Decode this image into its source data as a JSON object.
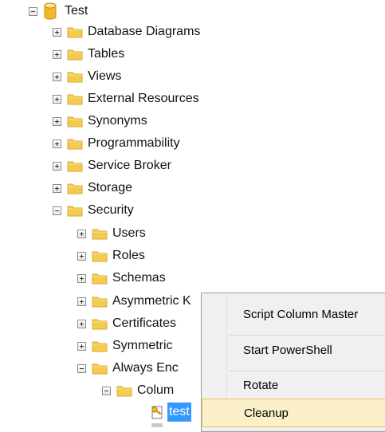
{
  "tree": {
    "root": {
      "label": "Test",
      "icon": "database-icon",
      "expanded": true
    },
    "items": [
      {
        "label": "Database Diagrams",
        "icon": "folder-icon",
        "expanded": false
      },
      {
        "label": "Tables",
        "icon": "folder-icon",
        "expanded": false
      },
      {
        "label": "Views",
        "icon": "folder-icon",
        "expanded": false
      },
      {
        "label": "External Resources",
        "icon": "folder-icon",
        "expanded": false
      },
      {
        "label": "Synonyms",
        "icon": "folder-icon",
        "expanded": false
      },
      {
        "label": "Programmability",
        "icon": "folder-icon",
        "expanded": false
      },
      {
        "label": "Service Broker",
        "icon": "folder-icon",
        "expanded": false
      },
      {
        "label": "Storage",
        "icon": "folder-icon",
        "expanded": false
      },
      {
        "label": "Security",
        "icon": "folder-icon",
        "expanded": true
      }
    ],
    "security_children": [
      {
        "label": "Users",
        "icon": "folder-icon",
        "expanded": false
      },
      {
        "label": "Roles",
        "icon": "folder-icon",
        "expanded": false
      },
      {
        "label": "Schemas",
        "icon": "folder-icon",
        "expanded": false
      },
      {
        "label": "Asymmetric K",
        "icon": "folder-icon",
        "expanded": false
      },
      {
        "label": "Certificates",
        "icon": "folder-icon",
        "expanded": false
      },
      {
        "label": "Symmetric",
        "icon": "folder-icon",
        "expanded": false
      },
      {
        "label": "Always Enc",
        "icon": "folder-icon",
        "expanded": true
      }
    ],
    "always_encrypted_children": [
      {
        "label": "Colum",
        "icon": "folder-icon",
        "expanded": true
      }
    ],
    "column_children": [
      {
        "label": "test",
        "icon": "key-icon",
        "selected": true
      }
    ]
  },
  "context_menu": {
    "items": [
      {
        "label": "Script Column Master"
      },
      {
        "label": "Start PowerShell"
      },
      {
        "label": "Rotate"
      },
      {
        "label": "Cleanup",
        "highlighted": true
      }
    ]
  },
  "colors": {
    "folder": "#f5cb4f",
    "folder_dark": "#d9a933",
    "db": "#f2b926",
    "selection": "#3399ff",
    "menu_highlight": "#fcf0c8",
    "menu_highlight_border": "#e5c365"
  }
}
